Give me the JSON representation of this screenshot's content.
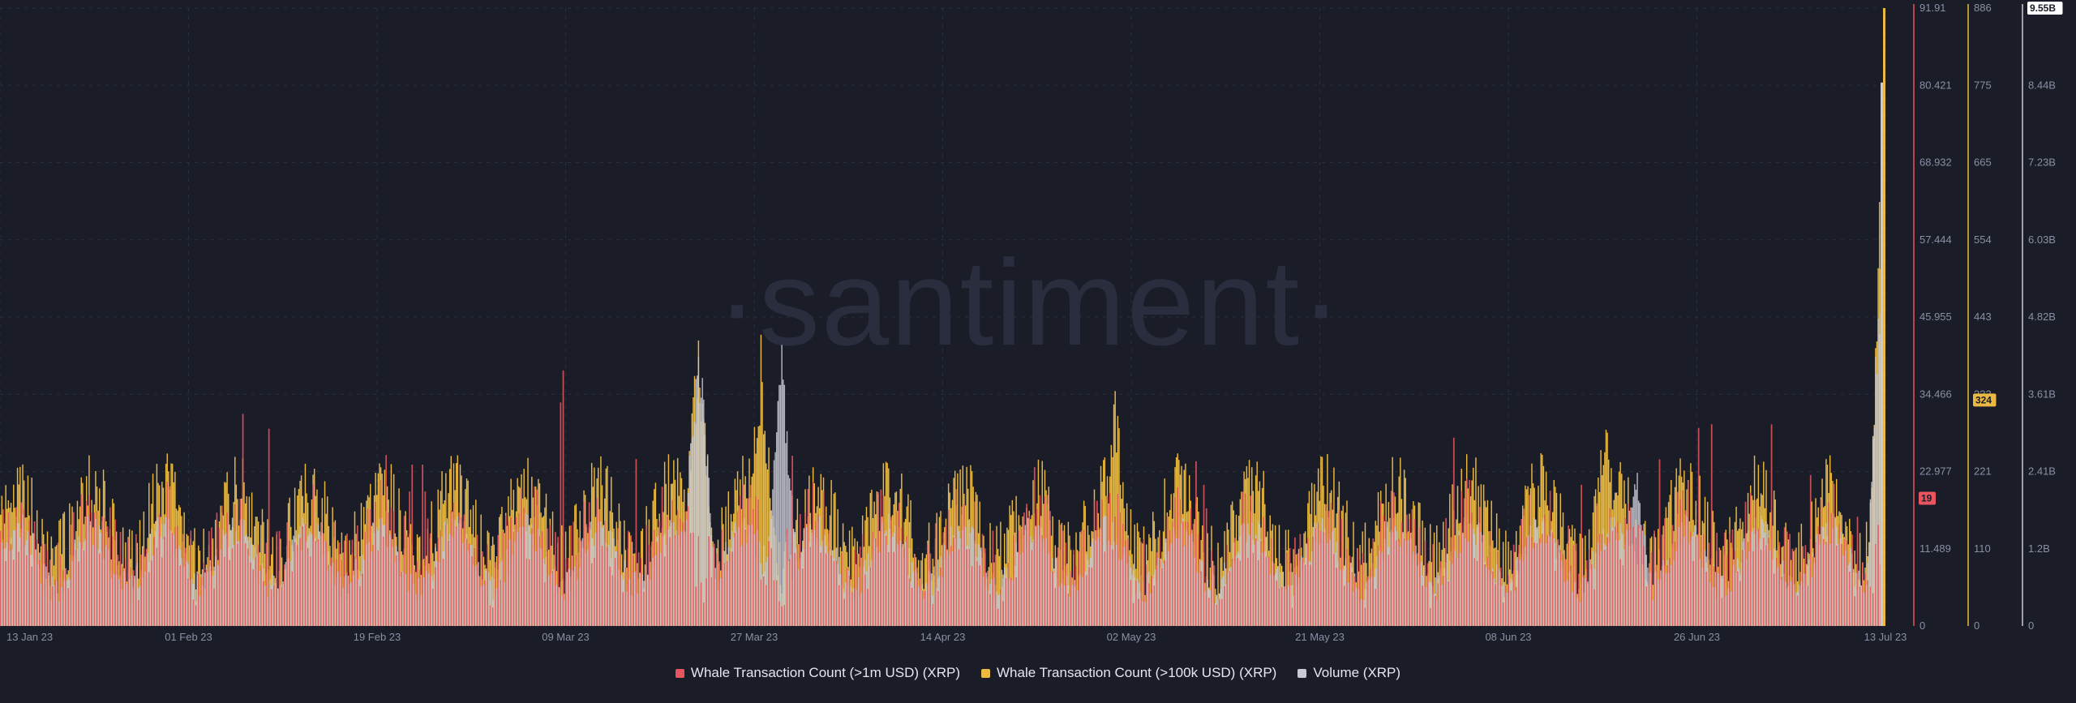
{
  "watermark": "·santiment·",
  "chart_data": {
    "type": "bar",
    "x_start": "2023-01-13",
    "x_end": "2023-07-13",
    "x_ticks": [
      "13 Jan 23",
      "01 Feb 23",
      "19 Feb 23",
      "09 Mar 23",
      "27 Mar 23",
      "14 Apr 23",
      "02 May 23",
      "21 May 23",
      "08 Jun 23",
      "26 Jun 23",
      "13 Jul 23"
    ],
    "axes": {
      "left": {
        "ticks": [
          "91.91",
          "80.421",
          "68.932",
          "57.444",
          "45.955",
          "34.466",
          "22.977",
          "11.489",
          "0"
        ],
        "ylim": [
          0,
          91.91
        ],
        "color": "#e8555e"
      },
      "middle": {
        "ticks": [
          "886",
          "775",
          "665",
          "554",
          "443",
          "332",
          "221",
          "110",
          "0"
        ],
        "ylim": [
          0,
          886
        ],
        "color": "#e9b941"
      },
      "right": {
        "ticks": [
          "9.55B",
          "8.44B",
          "7.23B",
          "6.03B",
          "4.82B",
          "3.61B",
          "2.41B",
          "1.2B",
          "0"
        ],
        "ylim": [
          0,
          9.55
        ],
        "color": "#c8cad3"
      }
    },
    "badges": {
      "left": "19",
      "middle": "324",
      "right": "9.55B"
    },
    "series": [
      {
        "name": "Whale Transaction Count (>1m USD) (XRP)",
        "color": "#e8555e",
        "axis": "left",
        "peaks": [
          {
            "date": "2023-02-22",
            "value": 32
          },
          {
            "date": "2023-03-08",
            "value": 38
          },
          {
            "date": "2023-04-22",
            "value": 27
          },
          {
            "date": "2023-05-08",
            "value": 28
          },
          {
            "date": "2023-06-14",
            "value": 24
          },
          {
            "date": "2023-07-11",
            "value": 26
          }
        ],
        "last_value": 19
      },
      {
        "name": "Whale Transaction Count (>100k USD) (XRP)",
        "color": "#e9b941",
        "axis": "middle",
        "peaks": [
          {
            "date": "2023-03-21",
            "value": 450
          },
          {
            "date": "2023-03-27",
            "value": 430
          },
          {
            "date": "2023-04-30",
            "value": 350
          },
          {
            "date": "2023-06-16",
            "value": 340
          },
          {
            "date": "2023-07-13",
            "value": 886
          }
        ],
        "last_value": 324
      },
      {
        "name": "Volume (XRP)",
        "color": "#c8cad3",
        "axis": "right",
        "peaks": [
          {
            "date": "2023-03-21",
            "value": 4.9
          },
          {
            "date": "2023-03-29",
            "value": 4.4
          },
          {
            "date": "2023-06-19",
            "value": 2.6
          },
          {
            "date": "2023-07-13",
            "value": 8.4
          }
        ],
        "last_value": 9.55
      }
    ],
    "grid": true,
    "legend_position": "bottom-center"
  }
}
